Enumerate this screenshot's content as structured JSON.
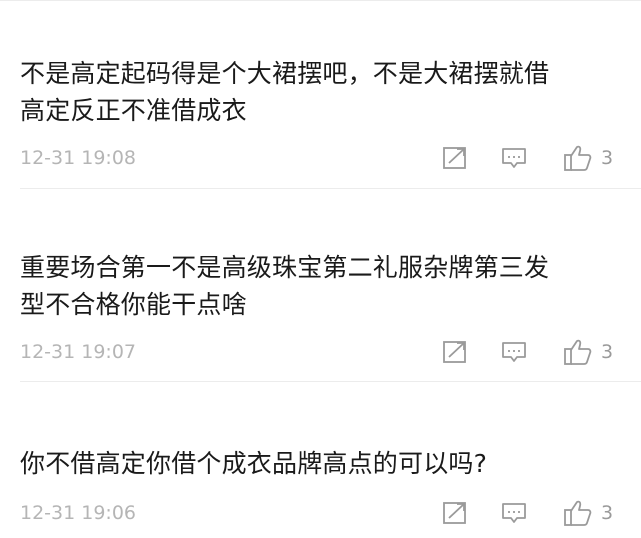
{
  "comments": [
    {
      "lines": [
        "不是高定起码得是个大裙摆吧，不是大裙摆就借",
        "高定反正不准借成衣"
      ],
      "time": "12-31 19:08",
      "likes": "3"
    },
    {
      "lines": [
        "重要场合第一不是高级珠宝第二礼服杂牌第三发",
        "型不合格你能干点啥"
      ],
      "time": "12-31 19:07",
      "likes": "3"
    },
    {
      "lines": [
        "你不借高定你借个成衣品牌高点的可以吗?"
      ],
      "time": "12-31 19:06",
      "likes": "3"
    }
  ],
  "icons": {
    "share": "share-icon",
    "reply": "reply-icon",
    "like": "thumbs-up-icon"
  },
  "colors": {
    "text": "#1a1a1a",
    "meta": "#b5b5b5",
    "icon": "#9a9a9a",
    "divider": "#ececec"
  }
}
